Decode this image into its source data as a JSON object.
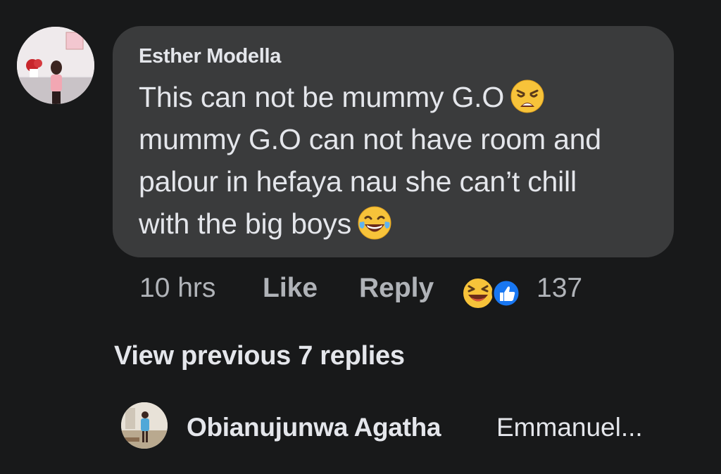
{
  "comment": {
    "author": "Esther Modella",
    "text_lines": [
      "This can not be mummy G.O",
      "mummy G.O can not have room and",
      "palour in hefaya nau she can’t chill",
      "with the big boys"
    ],
    "emojis": [
      "weary-face-emoji",
      "tears-of-joy-emoji"
    ],
    "timestamp": "10 hrs",
    "like_label": "Like",
    "reply_label": "Reply",
    "reaction_icons": [
      "laughing-reaction-icon",
      "like-reaction-icon"
    ],
    "reaction_count": "137"
  },
  "thread": {
    "view_previous_label": "View previous 7 replies"
  },
  "reply": {
    "author": "Obianujunwa Agatha",
    "preview": "Emmanuel..."
  },
  "colors": {
    "background": "#18191a",
    "bubble": "#3a3b3c",
    "primary_text": "#e4e6eb",
    "secondary_text": "#b0b3b8",
    "like_blue": "#1877f2",
    "emoji_yellow": "#f7c33a"
  }
}
